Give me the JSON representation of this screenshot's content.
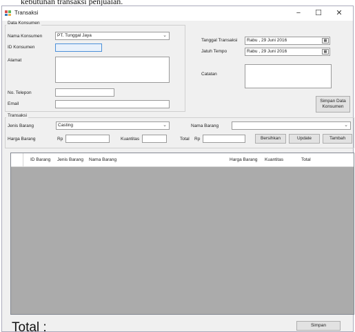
{
  "caption_fragment": "kebutuhan transaksi penjualan.",
  "window": {
    "title": "Transaksi",
    "minimize": "−",
    "maximize": "☐",
    "close": "✕"
  },
  "customer_group": {
    "title": "Data Konsumen",
    "name_label": "Nama Konsumen",
    "name_value": "PT. Tunggal Jaya",
    "id_label": "ID Konsumen",
    "id_value": "",
    "address_label": "Alamat",
    "address_value": "",
    "phone_label": "No. Telepon",
    "phone_value": "",
    "email_label": "Email",
    "email_value": ""
  },
  "transaction_info": {
    "date_label": "Tanggal Transaksi",
    "date_value": "Rabu , 29    Juni    2016",
    "due_label": "Jatuh Tempo",
    "due_value": "Rabu , 29    Juni    2016",
    "notes_label": "Catatan",
    "notes_value": "",
    "save_customer_button": "Simpan Data Konsumen"
  },
  "item_group": {
    "title": "Transaksi",
    "type_label": "Jenis Barang",
    "type_value": "Casting",
    "name_label": "Nama Barang",
    "name_value": "",
    "price_label": "Harga Barang",
    "currency_prefix": "Rp",
    "price_value": "",
    "qty_label": "Kuantitas",
    "qty_value": "",
    "total_label": "Total",
    "total_prefix": "Rp",
    "total_value": "",
    "clear_button": "Bersihkan",
    "update_button": "Update",
    "add_button": "Tambah"
  },
  "grid": {
    "columns": [
      "ID Barang",
      "Jenis Barang",
      "Nama Barang",
      "Harga Barang",
      "Kuantitas",
      "Total"
    ]
  },
  "footer": {
    "total_label": "Total :",
    "save_button": "Simpan"
  },
  "icons": {
    "app": "app-window-icon",
    "dropdown": "chevron-down-icon",
    "calendar": "calendar-icon"
  },
  "colors": {
    "window_bg": "#f0f0f0",
    "grid_bg": "#ababab",
    "focus_border": "#4a8fd8"
  }
}
